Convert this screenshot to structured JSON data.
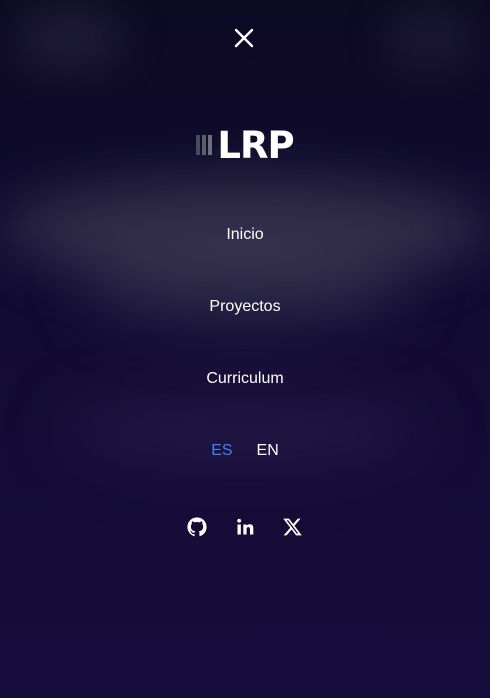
{
  "colors": {
    "text": "#ffffff",
    "accent": "#3b82f6",
    "background_top": "#0d0a24",
    "background_bottom": "#170d3d",
    "logo_bars": [
      "#4a4a58",
      "#5c5c6a",
      "#6e6e7c"
    ]
  },
  "menu": {
    "close_icon": "close-icon"
  },
  "logo": {
    "text": "LRP"
  },
  "nav": {
    "items": [
      {
        "label": "Inicio"
      },
      {
        "label": "Proyectos"
      },
      {
        "label": "Curriculum"
      }
    ]
  },
  "language": {
    "options": [
      {
        "code": "ES",
        "active": true
      },
      {
        "code": "EN",
        "active": false
      }
    ]
  },
  "social": {
    "icons": [
      "github-icon",
      "linkedin-icon",
      "x-icon"
    ]
  }
}
